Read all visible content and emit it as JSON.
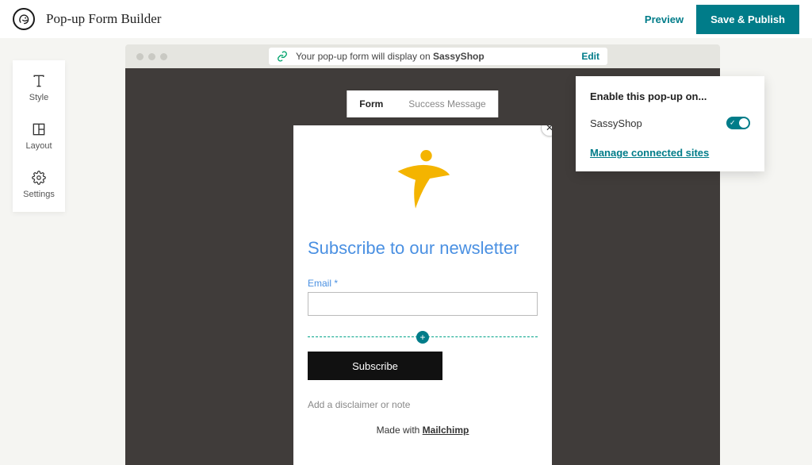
{
  "app": {
    "title": "Pop-up Form Builder"
  },
  "topbar": {
    "preview": "Preview",
    "publish": "Save & Publish"
  },
  "tools": {
    "style": "Style",
    "layout": "Layout",
    "settings": "Settings"
  },
  "urlbar": {
    "prefix": "Your pop-up form will display on ",
    "site": "SassyShop",
    "edit": "Edit"
  },
  "tabs": {
    "form": "Form",
    "success": "Success Message"
  },
  "popup": {
    "heading": "Subscribe to our newsletter",
    "email_label": "Email ",
    "required_mark": "*",
    "subscribe": "Subscribe",
    "disclaimer": "Add a disclaimer or note",
    "madewith_prefix": "Made with ",
    "madewith_brand": "Mailchimp"
  },
  "enable": {
    "title": "Enable this pop-up on...",
    "site": "SassyShop",
    "manage": "Manage connected sites"
  }
}
